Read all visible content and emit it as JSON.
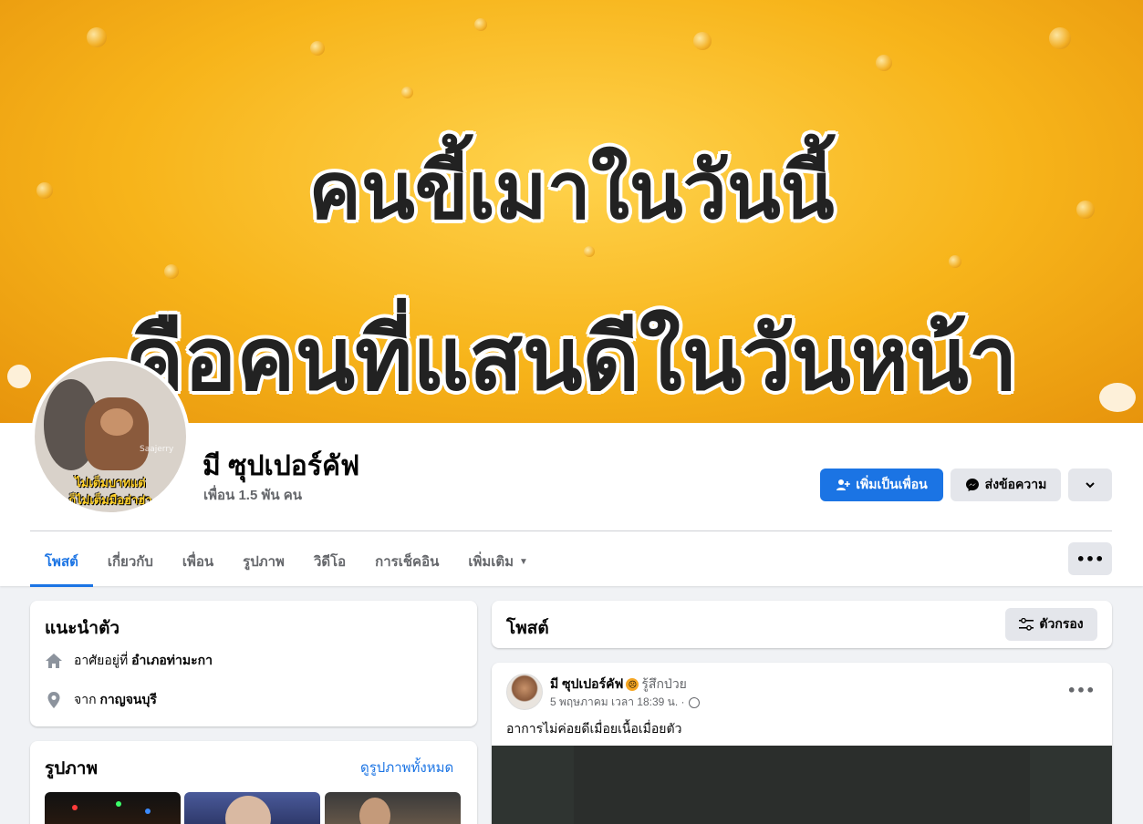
{
  "cover": {
    "line1": "คนขี้เมาในวันนี้",
    "line2": "คือคนที่แสนดีในวันหน้า"
  },
  "avatar": {
    "caption_line1": "ไม่เต็มบาทแต่",
    "caption_line2": "ก็ไม่เต็มมือฮ่าฮ่า",
    "watermark": "Saajerry"
  },
  "profile": {
    "name": "มี ซุปเปอร์คัฟ",
    "friends": "เพื่อน 1.5 พัน คน"
  },
  "actions": {
    "add_friend": "เพิ่มเป็นเพื่อน",
    "message": "ส่งข้อความ",
    "add_friend_icon": "add-friend-icon",
    "message_icon": "messenger-icon",
    "more_icon": "chevron-down-icon"
  },
  "tabs": [
    {
      "label": "โพสต์",
      "active": true
    },
    {
      "label": "เกี่ยวกับ"
    },
    {
      "label": "เพื่อน"
    },
    {
      "label": "รูปภาพ"
    },
    {
      "label": "วิดีโอ"
    },
    {
      "label": "การเช็คอิน"
    },
    {
      "label": "เพิ่มเติม"
    }
  ],
  "intro": {
    "title": "แนะนำตัว",
    "rows": [
      {
        "icon": "home-icon",
        "label": "อาศัยอยู่ที่",
        "value": "อำเภอท่ามะกา"
      },
      {
        "icon": "location-pin-icon",
        "label": "จาก",
        "value": "กาญจนบุรี"
      }
    ]
  },
  "photos": {
    "title": "รูปภาพ",
    "see_all": "ดูรูปภาพทั้งหมด"
  },
  "posts": {
    "title": "โพสต์",
    "filter": "ตัวกรอง"
  },
  "post": {
    "author": "มี ซุปเปอร์คัฟ",
    "feeling_emoji": "sick-face-emoji",
    "feeling": "รู้สึกป่วย",
    "timestamp": "5 พฤษภาคม เวลา 18:39 น. ·",
    "privacy_icon": "globe-icon",
    "text": "อาการไม่ค่อยดีเมื่อยเนื้อเมื่อยตัว"
  },
  "colors": {
    "accent": "#1b74e4",
    "page_bg": "#f0f2f5",
    "secondary_button": "#e4e6eb"
  }
}
